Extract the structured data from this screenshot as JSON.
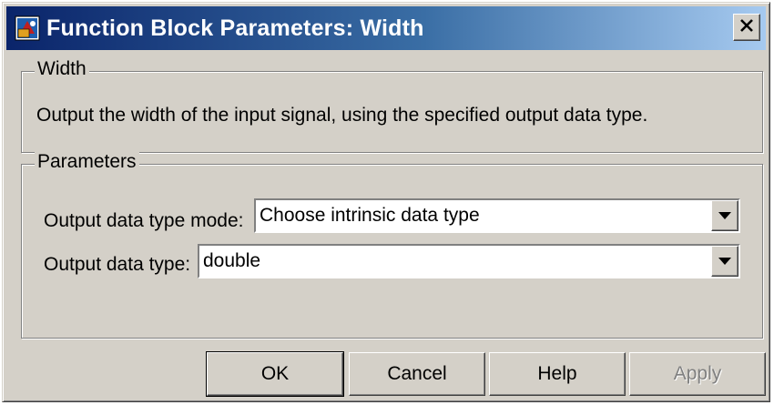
{
  "window": {
    "title": "Function Block Parameters: Width",
    "icon": "simulink-block-icon",
    "close_icon": "close-icon"
  },
  "description_group": {
    "legend": "Width",
    "text": "Output the width of the input signal, using the specified output data type."
  },
  "parameters_group": {
    "legend": "Parameters",
    "mode": {
      "label": "Output data type mode:",
      "value": "Choose intrinsic data type"
    },
    "type": {
      "label": "Output data type:",
      "value": "double"
    }
  },
  "buttons": {
    "ok": "OK",
    "cancel": "Cancel",
    "help": "Help",
    "apply": "Apply"
  },
  "colors": {
    "titlebar_start": "#0a246a",
    "titlebar_end": "#a6caf0",
    "face": "#d4d0c8",
    "disabled_text": "#808080"
  }
}
